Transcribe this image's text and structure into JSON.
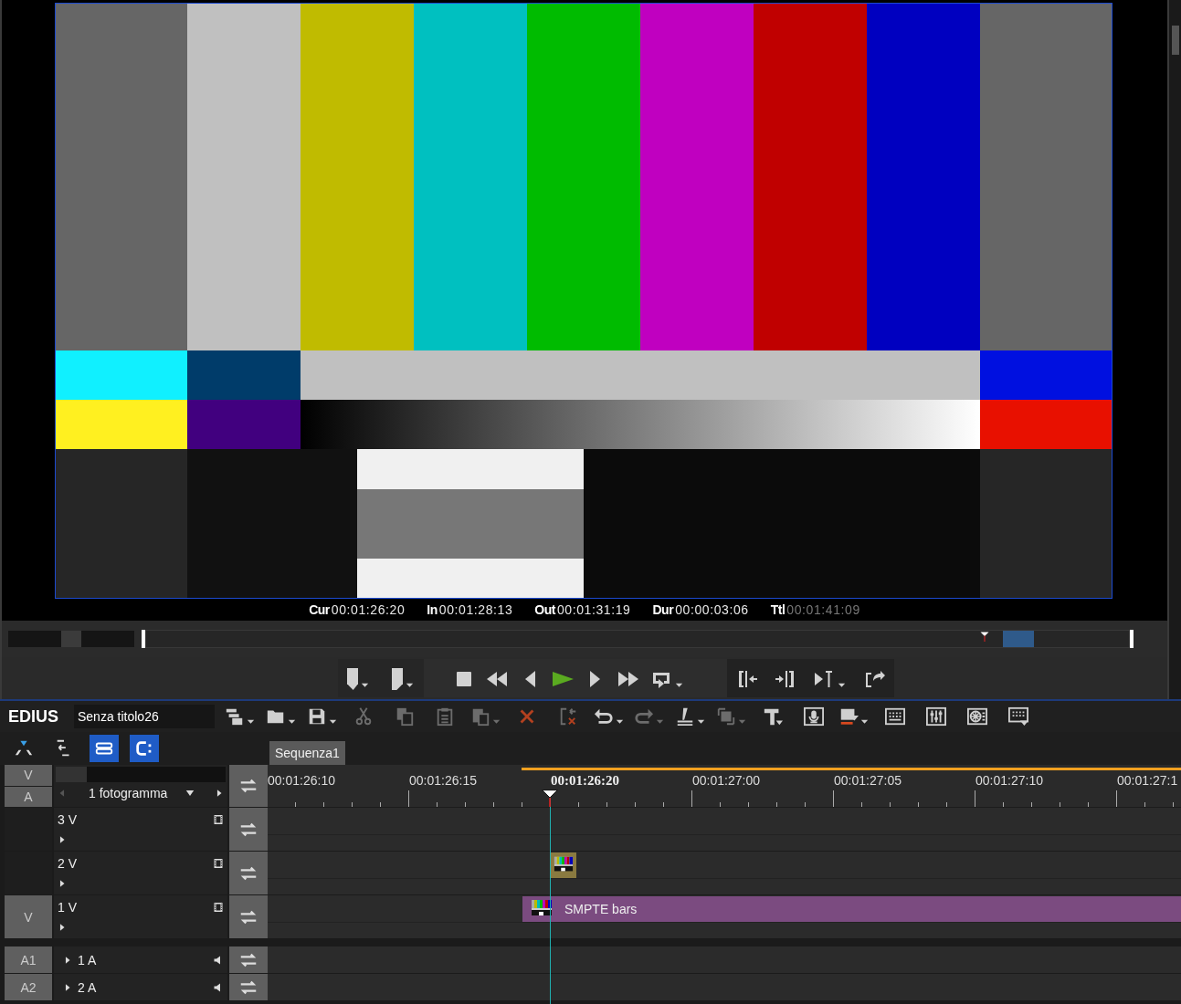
{
  "monitor": {
    "timecodes": [
      {
        "label": "Cur",
        "value": "00:01:26:20",
        "dimmed": false
      },
      {
        "label": "In",
        "value": "00:01:28:13",
        "dimmed": false
      },
      {
        "label": "Out",
        "value": "00:01:31:19",
        "dimmed": false
      },
      {
        "label": "Dur",
        "value": "00:00:03:06",
        "dimmed": false
      },
      {
        "label": "Ttl",
        "value": "00:01:41:09",
        "dimmed": true
      }
    ],
    "shuttle_slider": {
      "level": 0.5
    },
    "position_slider": {
      "level": 0.853
    }
  },
  "toolbar": {
    "app_name": "EDIUS",
    "project_name": "Senza titolo26",
    "tools": [
      {
        "disabled": false
      },
      {
        "disabled": false
      },
      {
        "disabled": false
      },
      {
        "disabled": true
      },
      {
        "disabled": true
      },
      {
        "disabled": true
      },
      {
        "disabled": true
      },
      {
        "disabled": false
      },
      {
        "disabled": true
      },
      {
        "disabled": false
      },
      {
        "disabled": true
      },
      {
        "disabled": false
      },
      {
        "disabled": true
      },
      {
        "disabled": false
      },
      {
        "disabled": false
      },
      {
        "disabled": false
      },
      {
        "disabled": false
      },
      {
        "disabled": false
      },
      {
        "disabled": false
      },
      {
        "disabled": false
      }
    ]
  },
  "mode_buttons": [
    {
      "on": false
    },
    {
      "on": false
    },
    {
      "on": true
    },
    {
      "on": true
    }
  ],
  "zoom_slider": {
    "level": 0
  },
  "sequence_tabs": [
    {
      "label": "Sequenza1",
      "selected": true
    }
  ],
  "track_header": {
    "modes": [
      "V",
      "A"
    ],
    "step": "1 fotogramma"
  },
  "ruler": {
    "labels": [
      {
        "text": "00:01:26:10",
        "current": false
      },
      {
        "text": "00:01:26:15",
        "current": false
      },
      {
        "text": "00:01:26:20",
        "current": true
      },
      {
        "text": "00:01:27:00",
        "current": false
      },
      {
        "text": "00:01:27:05",
        "current": false
      },
      {
        "text": "00:01:27:10",
        "current": false
      },
      {
        "text": "00:01:27:1",
        "current": false
      }
    ]
  },
  "tracks": [
    {
      "kind": "video",
      "name": "3 V"
    },
    {
      "kind": "video",
      "name": "2 V",
      "clips": [
        {
          "kind": "icon"
        }
      ]
    },
    {
      "kind": "video",
      "name": "1 V",
      "patch": "V",
      "clips": [
        {
          "kind": "bar",
          "label": "SMPTE bars"
        }
      ]
    },
    {
      "kind": "audio",
      "name": "1 A",
      "patch": "A1"
    },
    {
      "kind": "audio",
      "name": "2 A",
      "patch": "A2"
    }
  ]
}
